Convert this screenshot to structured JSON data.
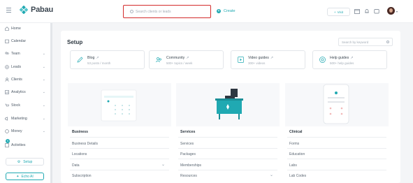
{
  "app": {
    "name": "Pabau"
  },
  "header": {
    "search_placeholder": "Search clients or leads",
    "create_label": "Create",
    "visit_label": "Visit"
  },
  "sidebar": {
    "items": [
      {
        "label": "Home",
        "icon": "home-icon",
        "chevron": false
      },
      {
        "label": "Calendar",
        "icon": "calendar-icon",
        "chevron": false
      },
      {
        "label": "Team",
        "icon": "team-icon",
        "chevron": true
      },
      {
        "label": "Leads",
        "icon": "leads-icon",
        "chevron": true
      },
      {
        "label": "Clients",
        "icon": "clients-icon",
        "chevron": true
      },
      {
        "label": "Analytics",
        "icon": "analytics-icon",
        "chevron": true
      },
      {
        "label": "Stock",
        "icon": "stock-icon",
        "chevron": true
      },
      {
        "label": "Marketing",
        "icon": "marketing-icon",
        "chevron": true
      },
      {
        "label": "Money",
        "icon": "money-icon",
        "chevron": true
      },
      {
        "label": "Activities",
        "icon": "activities-icon",
        "chevron": false
      }
    ],
    "activities_badge": "9",
    "setup_label": "Setup",
    "echo_label": "Echo AI"
  },
  "main": {
    "title": "Setup",
    "keyword_placeholder": "Search by keyword",
    "resources": [
      {
        "title": "Blog",
        "subtitle": "53 posts / month",
        "icon": "pen-icon"
      },
      {
        "title": "Community",
        "subtitle": "500+ topics / week",
        "icon": "community-icon"
      },
      {
        "title": "Video guides",
        "subtitle": "300+ videos",
        "icon": "video-icon"
      },
      {
        "title": "Help guides",
        "subtitle": "500+ help guides",
        "icon": "help-icon"
      }
    ],
    "columns": [
      {
        "title": "Business",
        "items": [
          {
            "label": "Business Details",
            "chevron": false
          },
          {
            "label": "Locations",
            "chevron": false
          },
          {
            "label": "Data",
            "chevron": true
          },
          {
            "label": "Subscription",
            "chevron": false
          }
        ]
      },
      {
        "title": "Services",
        "items": [
          {
            "label": "Services",
            "chevron": false
          },
          {
            "label": "Packages",
            "chevron": false
          },
          {
            "label": "Memberships",
            "chevron": false
          },
          {
            "label": "Resources",
            "chevron": true
          }
        ]
      },
      {
        "title": "Clinical",
        "items": [
          {
            "label": "Forms",
            "chevron": false
          },
          {
            "label": "Education",
            "chevron": false
          },
          {
            "label": "Labs",
            "chevron": false
          },
          {
            "label": "Lab Codes",
            "chevron": false
          }
        ]
      }
    ]
  },
  "colors": {
    "accent": "#20a9b2",
    "highlight": "#d32c2c",
    "background": "#f4f5f7"
  }
}
